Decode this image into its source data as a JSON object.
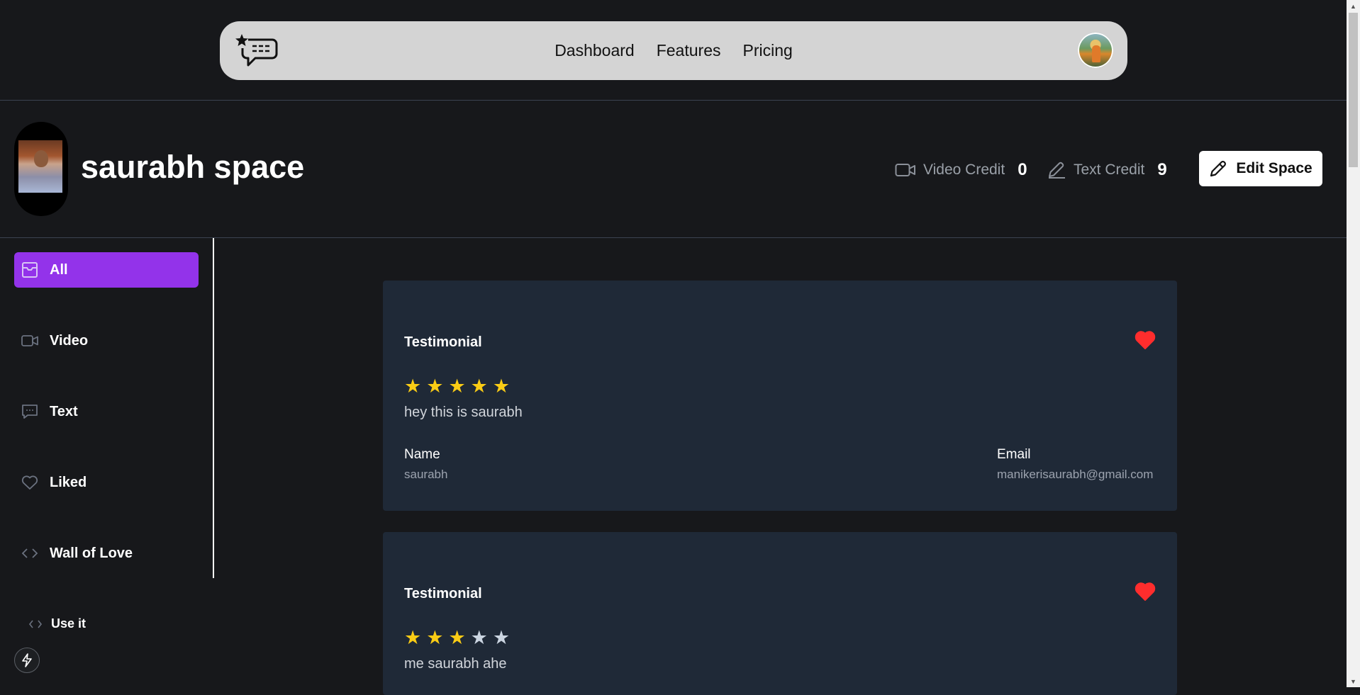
{
  "navbar": {
    "links": [
      "Dashboard",
      "Features",
      "Pricing"
    ],
    "logo_icon": "chat-star-icon",
    "avatar_icon": "user-avatar"
  },
  "space": {
    "title": "saurabh space",
    "video_credit_label": "Video Credit",
    "video_credit_value": "0",
    "text_credit_label": "Text Credit",
    "text_credit_value": "9",
    "edit_label": "Edit Space"
  },
  "sidebar": {
    "items": [
      {
        "label": "All",
        "icon": "inbox-icon",
        "active": true
      },
      {
        "label": "Video",
        "icon": "video-icon"
      },
      {
        "label": "Text",
        "icon": "message-icon"
      },
      {
        "label": "Liked",
        "icon": "heart-icon"
      },
      {
        "label": "Wall of Love",
        "icon": "code-icon"
      }
    ],
    "use_it_label": "Use it"
  },
  "testimonials": [
    {
      "title": "Testimonial",
      "rating": 5,
      "max_rating": 5,
      "message": "hey this is saurabh",
      "name_label": "Name",
      "name": "saurabh",
      "email_label": "Email",
      "email": "manikerisaurabh@gmail.com",
      "liked": true
    },
    {
      "title": "Testimonial",
      "rating": 3,
      "max_rating": 5,
      "message": "me saurabh ahe",
      "liked": true
    }
  ],
  "colors": {
    "accent": "#9333ea",
    "card_bg": "#1f2937",
    "star": "#facc15",
    "heart": "#ff2d2d",
    "background": "#17181b"
  }
}
